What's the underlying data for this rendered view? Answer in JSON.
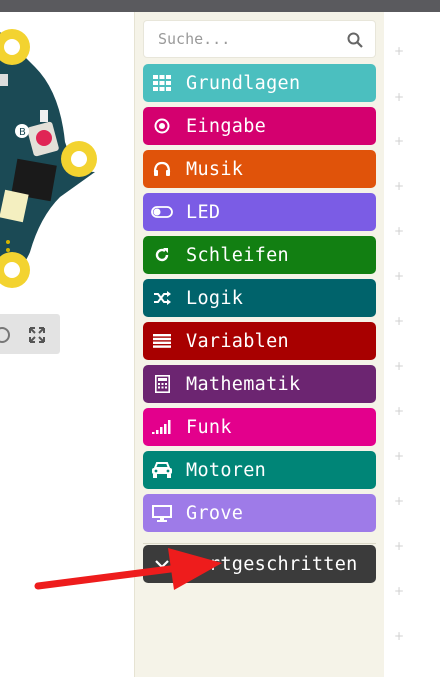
{
  "search": {
    "placeholder": "Suche..."
  },
  "categories": [
    {
      "label": "Grundlagen",
      "color": "#4bbfbf",
      "icon": "grid-icon"
    },
    {
      "label": "Eingabe",
      "color": "#d4006f",
      "icon": "radio-target-icon"
    },
    {
      "label": "Musik",
      "color": "#e0530a",
      "icon": "headphones-icon"
    },
    {
      "label": "LED",
      "color": "#7b5ce5",
      "icon": "toggle-icon"
    },
    {
      "label": "Schleifen",
      "color": "#127f12",
      "icon": "refresh-icon"
    },
    {
      "label": "Logik",
      "color": "#00636b",
      "icon": "shuffle-icon"
    },
    {
      "label": "Variablen",
      "color": "#a80000",
      "icon": "list-icon"
    },
    {
      "label": "Mathematik",
      "color": "#6c2571",
      "icon": "calculator-icon"
    },
    {
      "label": "Funk",
      "color": "#e3008c",
      "icon": "signal-icon"
    },
    {
      "label": "Motoren",
      "color": "#008577",
      "icon": "car-icon"
    },
    {
      "label": "Grove",
      "color": "#9e7be8",
      "icon": "monitor-icon"
    }
  ],
  "advanced": {
    "label": "Fortgeschritten",
    "color": "#3b3b3b",
    "icon": "chevron-down-icon"
  },
  "annotation": {
    "color": "#ee1c1c"
  }
}
